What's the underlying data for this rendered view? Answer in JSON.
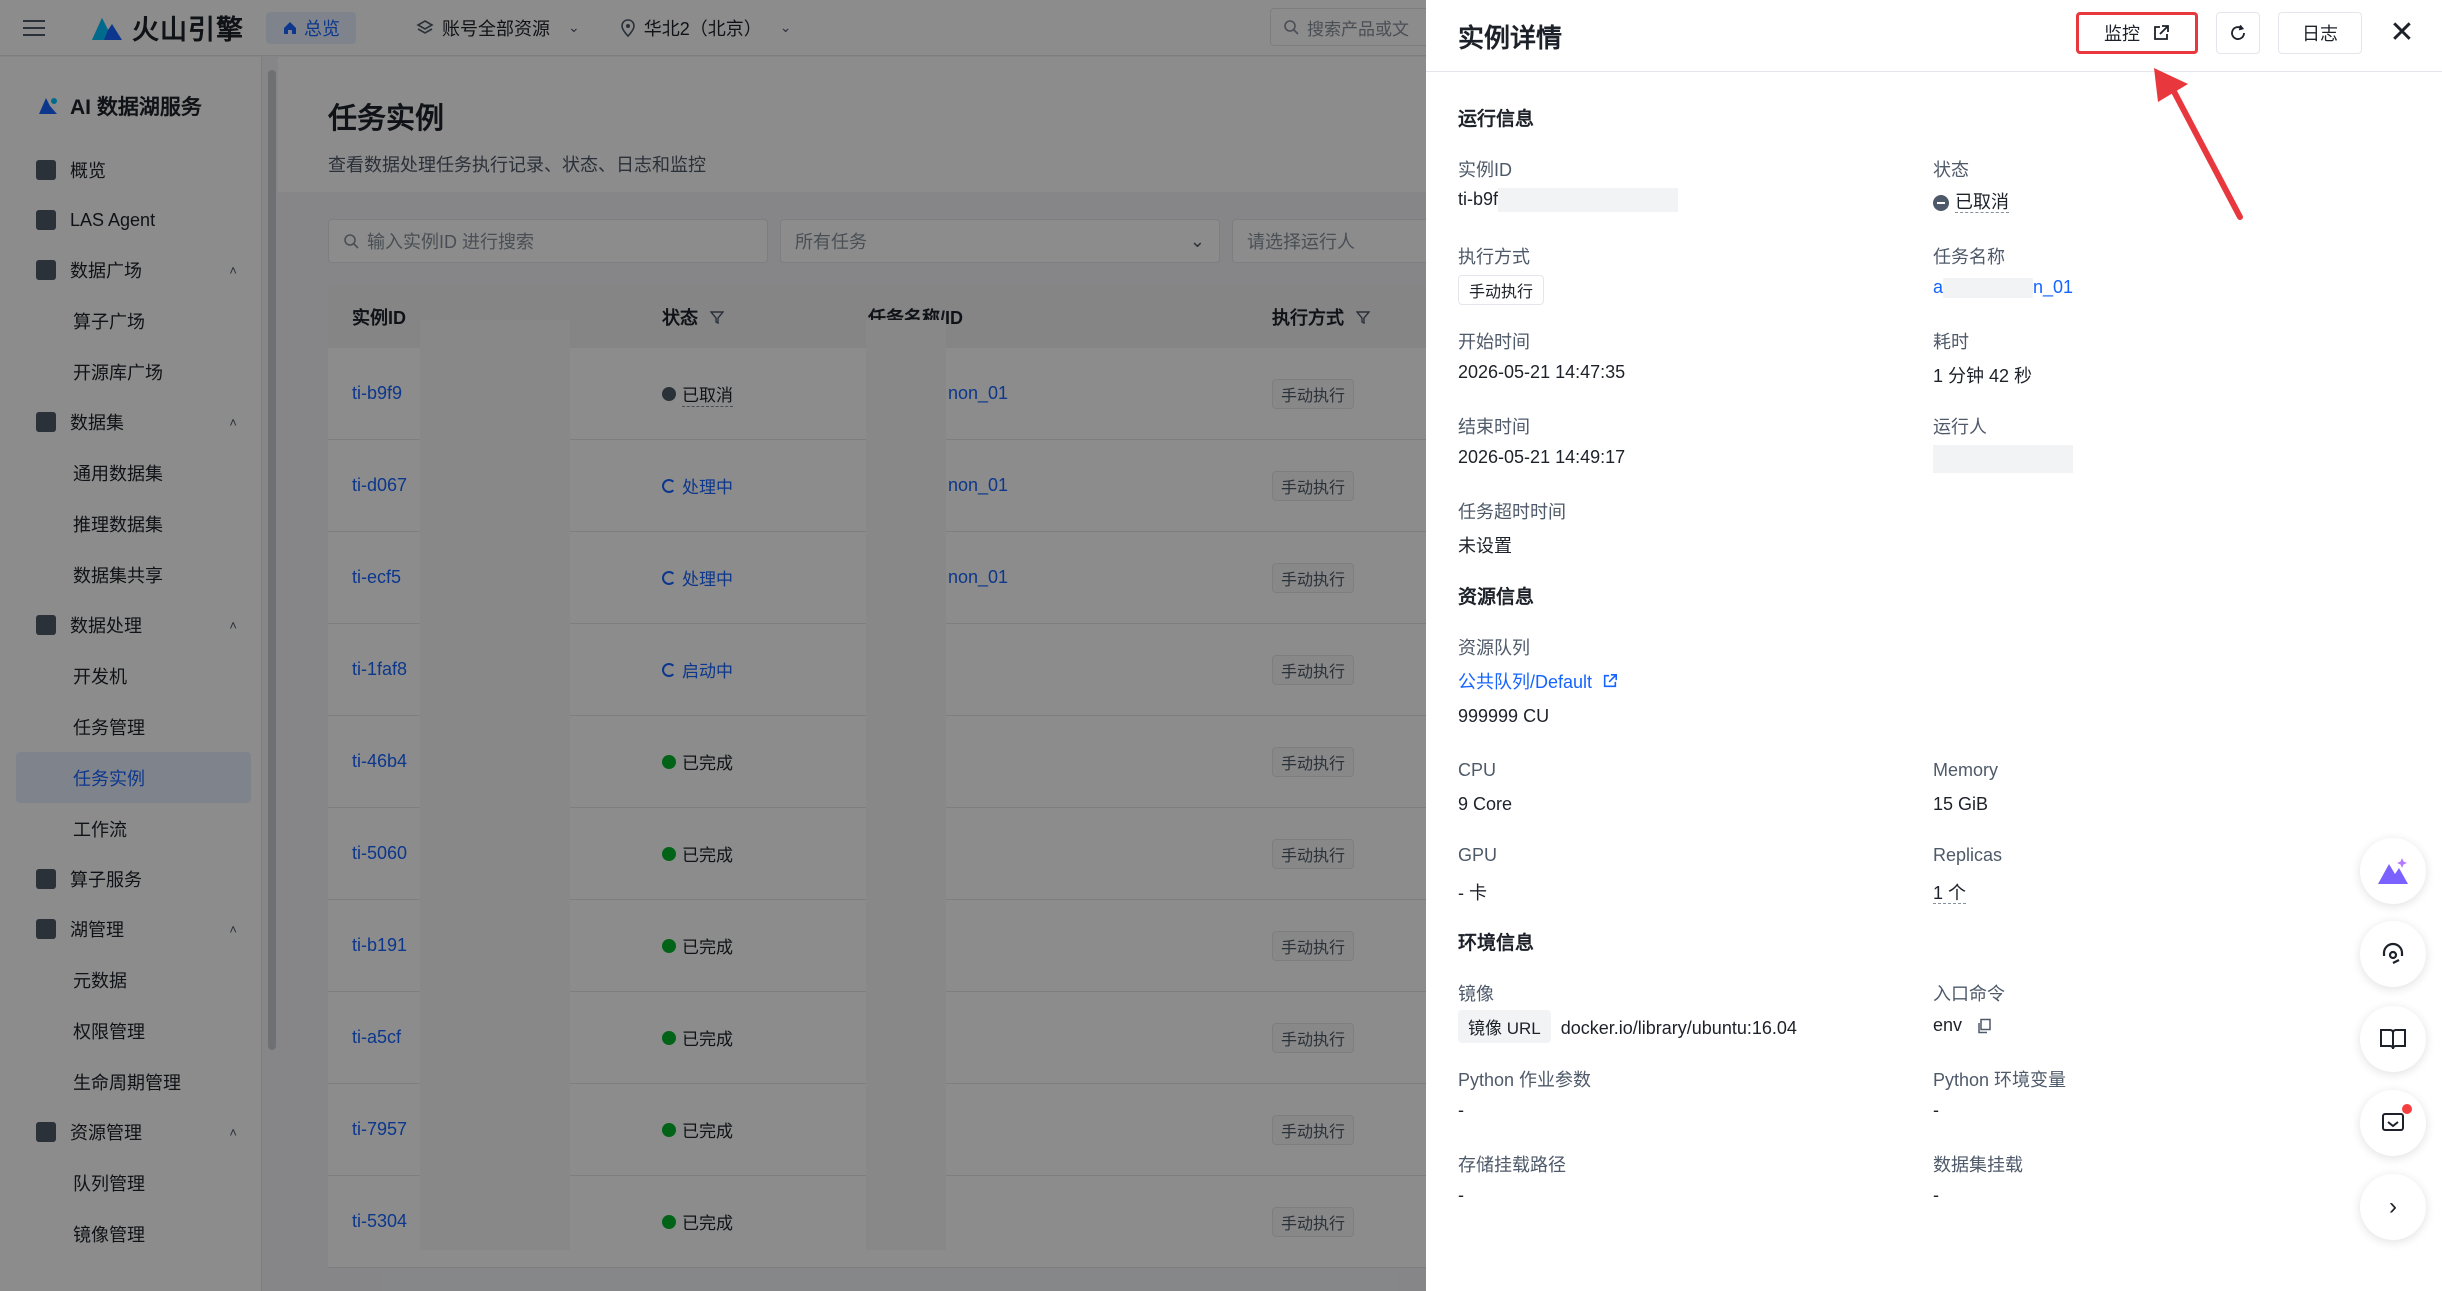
{
  "topbar": {
    "brand": "火山引擎",
    "home": "总览",
    "account": "账号全部资源",
    "region": "华北2（北京）",
    "search_placeholder": "搜索产品或文"
  },
  "sidebar": {
    "service_title": "AI 数据湖服务",
    "items": [
      {
        "type": "group",
        "label": "概览"
      },
      {
        "type": "group",
        "label": "LAS Agent"
      },
      {
        "type": "group",
        "label": "数据广场",
        "expanded": true
      },
      {
        "type": "item",
        "label": "算子广场"
      },
      {
        "type": "item",
        "label": "开源库广场"
      },
      {
        "type": "group",
        "label": "数据集",
        "expanded": true
      },
      {
        "type": "item",
        "label": "通用数据集"
      },
      {
        "type": "item",
        "label": "推理数据集"
      },
      {
        "type": "item",
        "label": "数据集共享"
      },
      {
        "type": "group",
        "label": "数据处理",
        "expanded": true
      },
      {
        "type": "item",
        "label": "开发机"
      },
      {
        "type": "item",
        "label": "任务管理"
      },
      {
        "type": "item",
        "label": "任务实例",
        "active": true
      },
      {
        "type": "item",
        "label": "工作流"
      },
      {
        "type": "group",
        "label": "算子服务"
      },
      {
        "type": "group",
        "label": "湖管理",
        "expanded": true
      },
      {
        "type": "item",
        "label": "元数据"
      },
      {
        "type": "item",
        "label": "权限管理"
      },
      {
        "type": "item",
        "label": "生命周期管理"
      },
      {
        "type": "group",
        "label": "资源管理",
        "expanded": true
      },
      {
        "type": "item",
        "label": "队列管理"
      },
      {
        "type": "item",
        "label": "镜像管理"
      }
    ]
  },
  "main": {
    "title": "任务实例",
    "subtitle": "查看数据处理任务执行记录、状态、日志和监控",
    "filters": {
      "search_placeholder": "输入实例ID 进行搜索",
      "task_select": "所有任务",
      "runner_placeholder": "请选择运行人"
    },
    "columns": {
      "id": "实例ID",
      "status": "状态",
      "task": "任务名称/ID",
      "exec": "执行方式"
    },
    "rows": [
      {
        "id": "ti-b9f9",
        "status": "已取消",
        "status_kind": "cancel",
        "task": "non_01",
        "exec": "手动执行"
      },
      {
        "id": "ti-d067",
        "status": "处理中",
        "status_kind": "run",
        "task": "non_01",
        "exec": "手动执行"
      },
      {
        "id": "ti-ecf5",
        "status": "处理中",
        "status_kind": "run",
        "task": "non_01",
        "exec": "手动执行"
      },
      {
        "id": "ti-1faf8",
        "status": "启动中",
        "status_kind": "run",
        "task": "",
        "exec": "手动执行"
      },
      {
        "id": "ti-46b4",
        "status": "已完成",
        "status_kind": "done",
        "task": "",
        "exec": "手动执行"
      },
      {
        "id": "ti-5060",
        "status": "已完成",
        "status_kind": "done",
        "task": "",
        "exec": "手动执行"
      },
      {
        "id": "ti-b191",
        "status": "已完成",
        "status_kind": "done",
        "task": "",
        "exec": "手动执行"
      },
      {
        "id": "ti-a5cf",
        "status": "已完成",
        "status_kind": "done",
        "task": "",
        "exec": "手动执行"
      },
      {
        "id": "ti-7957",
        "status": "已完成",
        "status_kind": "done",
        "task": "",
        "exec": "手动执行"
      },
      {
        "id": "ti-5304",
        "status": "已完成",
        "status_kind": "done",
        "task": "",
        "exec": "手动执行"
      }
    ]
  },
  "drawer": {
    "title": "实例详情",
    "monitor_label": "监控",
    "log_label": "日志",
    "run_info": {
      "section": "运行信息",
      "instance_id_label": "实例ID",
      "instance_id": "ti-b9f",
      "status_label": "状态",
      "status": "已取消",
      "exec_label": "执行方式",
      "exec": "手动执行",
      "task_name_label": "任务名称",
      "task_name_prefix": "a",
      "task_name_suffix": "n_01",
      "start_label": "开始时间",
      "start": "2026-05-21 14:47:35",
      "duration_label": "耗时",
      "duration": "1 分钟 42 秒",
      "end_label": "结束时间",
      "end": "2026-05-21 14:49:17",
      "runner_label": "运行人",
      "timeout_label": "任务超时时间",
      "timeout": "未设置"
    },
    "resource_info": {
      "section": "资源信息",
      "queue_label": "资源队列",
      "queue": "公共队列/Default",
      "cu": "999999 CU",
      "cpu_label": "CPU",
      "cpu": "9 Core",
      "memory_label": "Memory",
      "memory": "15 GiB",
      "gpu_label": "GPU",
      "gpu": "- 卡",
      "replicas_label": "Replicas",
      "replicas": "1 个"
    },
    "env_info": {
      "section": "环境信息",
      "image_label": "镜像",
      "image_tag": "镜像 URL",
      "image_url": "docker.io/library/ubuntu:16.04",
      "entry_label": "入口命令",
      "entry": "env",
      "py_args_label": "Python 作业参数",
      "py_args": "-",
      "py_env_label": "Python 环境变量",
      "py_env": "-",
      "mount_label": "存储挂载路径",
      "mount": "-",
      "dataset_label": "数据集挂载",
      "dataset": "-"
    }
  },
  "colors": {
    "primary": "#1664ff",
    "success": "#00b42a",
    "highlight": "#e8383d"
  }
}
